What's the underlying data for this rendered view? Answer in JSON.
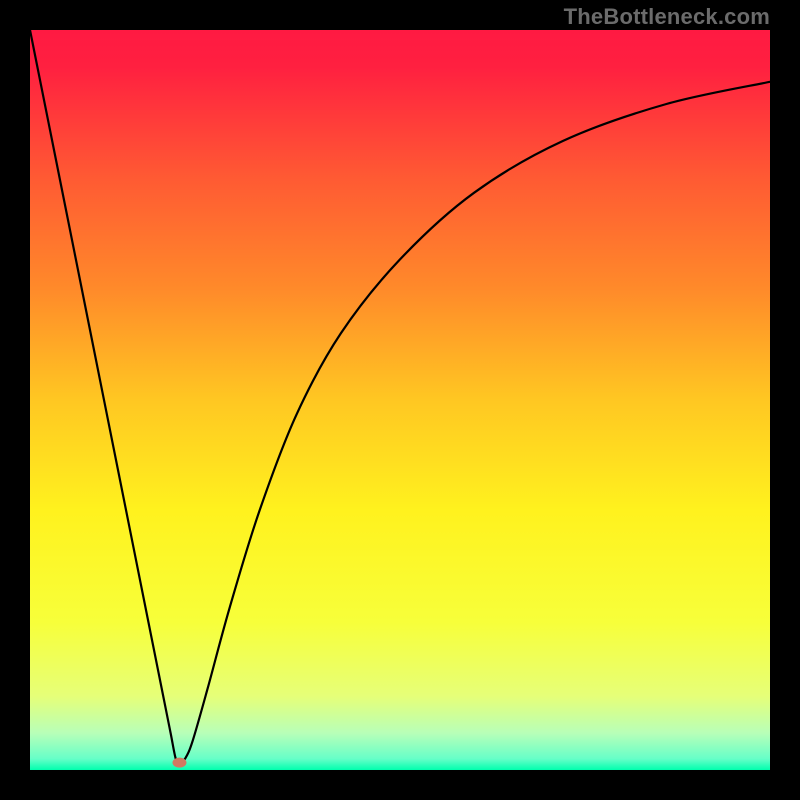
{
  "attribution": "TheBottleneck.com",
  "chart_data": {
    "type": "line",
    "title": "",
    "xlabel": "",
    "ylabel": "",
    "xlim": [
      0,
      100
    ],
    "ylim": [
      0,
      100
    ],
    "background_gradient": {
      "stops": [
        {
          "offset": 0.0,
          "color": "#ff1a42"
        },
        {
          "offset": 0.05,
          "color": "#ff2040"
        },
        {
          "offset": 0.2,
          "color": "#ff5a33"
        },
        {
          "offset": 0.35,
          "color": "#ff8a2a"
        },
        {
          "offset": 0.5,
          "color": "#ffc722"
        },
        {
          "offset": 0.65,
          "color": "#fff21e"
        },
        {
          "offset": 0.8,
          "color": "#f7ff3a"
        },
        {
          "offset": 0.9,
          "color": "#e6ff78"
        },
        {
          "offset": 0.95,
          "color": "#b8ffb8"
        },
        {
          "offset": 0.985,
          "color": "#66ffc8"
        },
        {
          "offset": 1.0,
          "color": "#00ffae"
        }
      ]
    },
    "series": [
      {
        "name": "bottleneck-curve",
        "color": "#000000",
        "stroke_width": 2.2,
        "x": [
          0,
          4,
          8,
          12,
          16,
          18,
          19,
          19.7,
          20.2,
          21,
          22,
          24,
          27,
          31,
          36,
          42,
          50,
          60,
          72,
          86,
          100
        ],
        "y": [
          100,
          80,
          60,
          40,
          20,
          10,
          5,
          1.5,
          1,
          1.6,
          4,
          11,
          22,
          35,
          48,
          59,
          69,
          78,
          85,
          90,
          93
        ]
      }
    ],
    "marker": {
      "name": "optimal-point",
      "x": 20.2,
      "y": 1,
      "color": "#d07a62",
      "rx": 7,
      "ry": 5
    }
  }
}
